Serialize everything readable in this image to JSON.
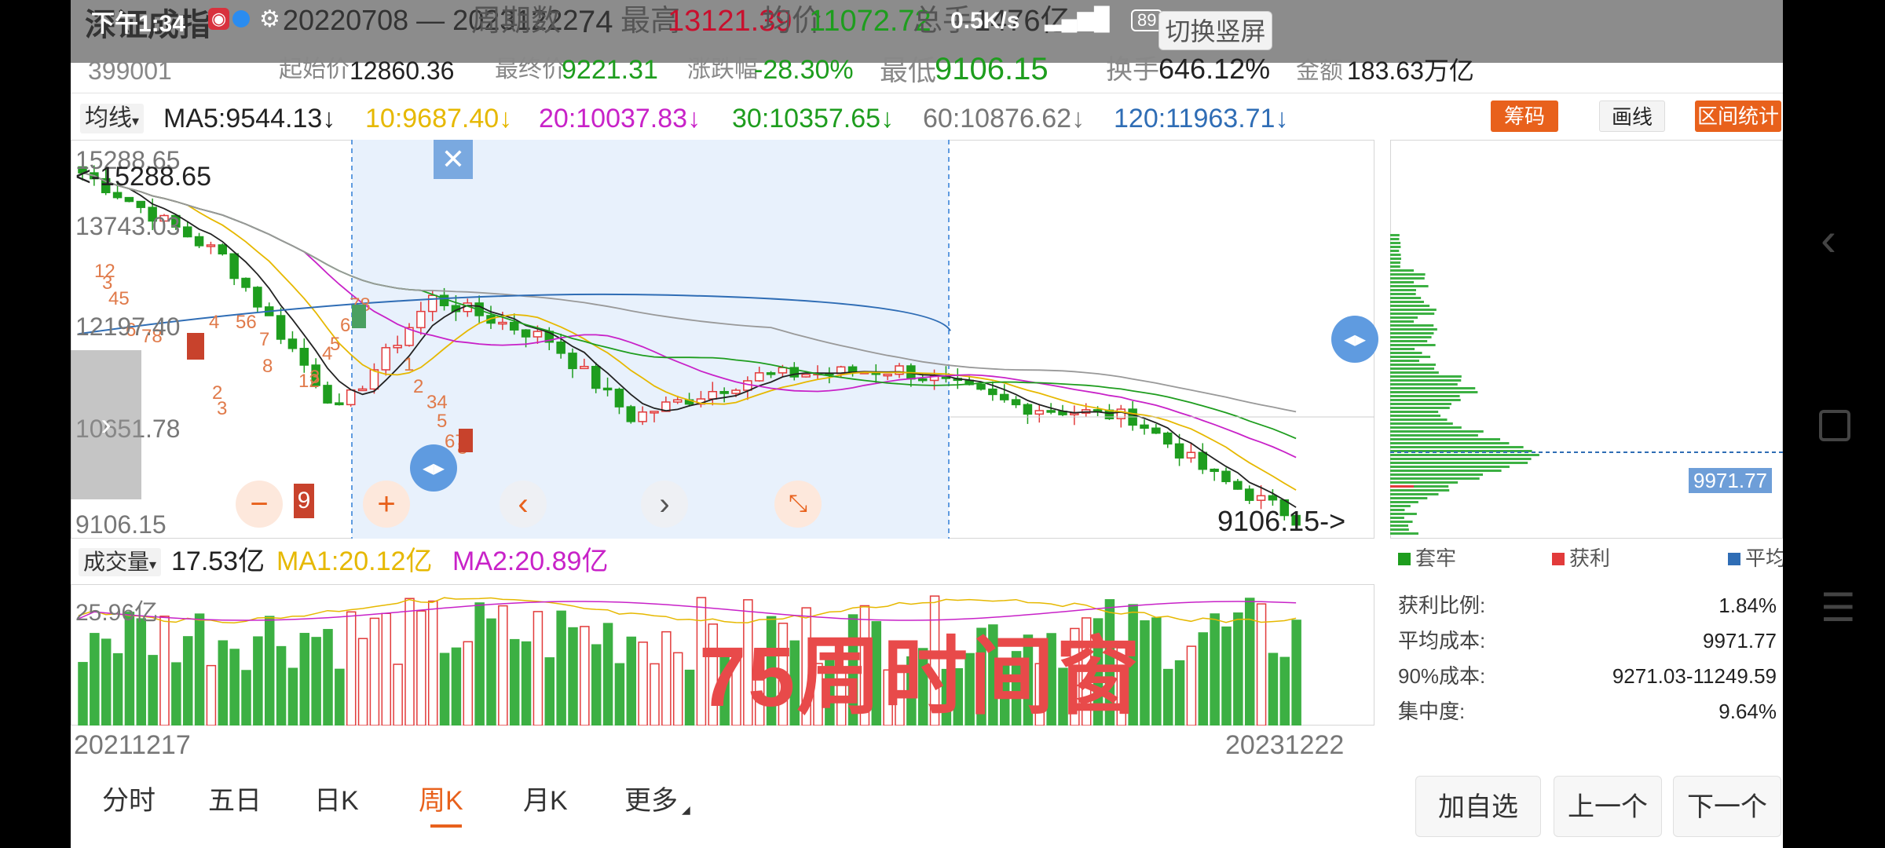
{
  "status_bar": {
    "time": "下午1:34",
    "network": "0.5K/s",
    "battery": "89"
  },
  "header": {
    "index_name": "深证成指",
    "code": "399001",
    "date_range": "20220708 — 20231222",
    "period_label": "周期数",
    "period_value": "74",
    "high_label": "最高",
    "high_value": "13121.39",
    "avg_label": "均价",
    "avg_value": "11072.72",
    "volume_label": "总手",
    "volume_value": "1476亿",
    "start_label": "起始价",
    "start_value": "12860.36",
    "end_label": "最终价",
    "end_value": "9221.31",
    "change_label": "涨跌幅",
    "change_value": "-28.30%",
    "low_label": "最低",
    "low_value": "9106.15",
    "turnover_label": "换手",
    "turnover_value": "646.12%",
    "amount_label": "金额",
    "amount_value": "183.63万亿",
    "switch_button": "切换竖屏"
  },
  "ma_bar": {
    "selector": "均线",
    "ma5": "MA5:9544.13↓",
    "ma10": "10:9687.40↓",
    "ma20": "20:10037.83↓",
    "ma30": "30:10357.65↓",
    "ma60": "60:10876.62↓",
    "ma120": "120:11963.71↓",
    "btn_chips": "筹码",
    "btn_draw": "画线",
    "btn_range": "区间统计"
  },
  "price_chart": {
    "y_labels": [
      "15288.65",
      "13743.03",
      "12197.40",
      "10651.78",
      "9106.15"
    ],
    "high_marker": "<-15288.65",
    "low_marker": "9106.15->",
    "nine_badge": "9",
    "colors": {
      "up": "#e23b3b",
      "down": "#1e9d1e",
      "ma5": "#222222",
      "ma10": "#e6b800",
      "ma20": "#c822c8",
      "ma30": "#1e9d1e",
      "ma60": "#999999",
      "ma120": "#2f6db5"
    }
  },
  "chart_data": {
    "type": "candlestick",
    "period": "weekly",
    "x_range": [
      "20211217",
      "20231222"
    ],
    "ylim": [
      9106.15,
      15288.65
    ],
    "selected_range": [
      "20220708",
      "20231222"
    ],
    "ma": {
      "MA5": 9544.13,
      "MA10": 9687.4,
      "MA20": 10037.83,
      "MA30": 10357.65,
      "MA60": 10876.62,
      "MA120": 11963.71
    },
    "volume": {
      "latest": "17.53亿",
      "MA1": "20.12亿",
      "MA2": "20.89亿",
      "ymax": "25.96亿"
    }
  },
  "chips_panel": {
    "avg_cost_tag": "9971.77",
    "legend": [
      "套牢",
      "获利",
      "平均"
    ],
    "stats": [
      {
        "label": "获利比例:",
        "value": "1.84%"
      },
      {
        "label": "平均成本:",
        "value": "9971.77"
      },
      {
        "label": "90%成本:",
        "value": "9271.03-11249.59"
      },
      {
        "label": "集中度:",
        "value": "9.64%"
      }
    ]
  },
  "volume_chart": {
    "selector": "成交量",
    "value": "17.53亿",
    "ma1": "MA1:20.12亿",
    "ma2": "MA2:20.89亿",
    "y_label": "25.96亿",
    "start_date": "20211217",
    "end_date": "20231222"
  },
  "overlay_text": "75周时间窗",
  "periods": {
    "tabs": [
      "分时",
      "五日",
      "日K",
      "周K",
      "月K",
      "更多"
    ],
    "active": "周K"
  },
  "actions": {
    "add": "加自选",
    "prev": "上一个",
    "next": "下一个"
  }
}
